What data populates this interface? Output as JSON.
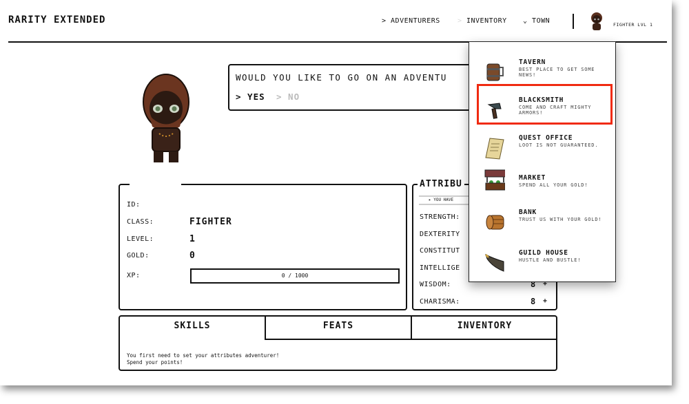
{
  "app": {
    "title": "RARITY EXTENDED"
  },
  "nav": {
    "adventurers": "> ADVENTURERS",
    "inventory": "INVENTORY",
    "town": "TOWN",
    "player": "FIGHTER LVL 1"
  },
  "dialog": {
    "question": "WOULD YOU LIKE TO GO ON AN ADVENTU",
    "yes": "> YES",
    "no": "> NO"
  },
  "stats": {
    "id_label": "ID:",
    "class_label": "CLASS:",
    "class": "FIGHTER",
    "level_label": "LEVEL:",
    "level": "1",
    "gold_label": "GOLD:",
    "gold": "0",
    "xp_label": "XP:",
    "xp": "0 / 1000",
    "xp_progress": 0
  },
  "attributes": {
    "title": "ATTRIBU",
    "points_text": "▸ YOU HAVE",
    "items": [
      {
        "label": "STRENGTH:"
      },
      {
        "label": "DEXTERITY"
      },
      {
        "label": "CONSTITUT"
      },
      {
        "label": "INTELLIGE"
      },
      {
        "label": "WISDOM:",
        "value": "8",
        "plus": "+"
      },
      {
        "label": "CHARISMA:",
        "value": "8",
        "plus": "+"
      }
    ]
  },
  "tabs": {
    "items": [
      "SKILLS",
      "FEATS",
      "INVENTORY"
    ],
    "active": "SKILLS",
    "content": "You first need to set your attributes adventurer! Spend your points!"
  },
  "town_menu": {
    "highlighted": "BLACKSMITH",
    "highlight_color": "#f02a10",
    "items": [
      {
        "name": "TAVERN",
        "desc": "BEST PLACE TO GET SOME NEWS!",
        "icon": "tavern-mug-icon"
      },
      {
        "name": "BLACKSMITH",
        "desc": "COME AND CRAFT MIGHTY ARMORS!",
        "icon": "hammer-icon"
      },
      {
        "name": "QUEST OFFICE",
        "desc": "LOOT IS NOT GUARANTEED.",
        "icon": "scroll-icon"
      },
      {
        "name": "MARKET",
        "desc": "SPEND ALL YOUR GOLD!",
        "icon": "market-stall-icon"
      },
      {
        "name": "BANK",
        "desc": "TRUST US WITH YOUR GOLD!",
        "icon": "coins-icon"
      },
      {
        "name": "GUILD HOUSE",
        "desc": "HUSTLE AND BUSTLE!",
        "icon": "horn-icon"
      }
    ]
  }
}
